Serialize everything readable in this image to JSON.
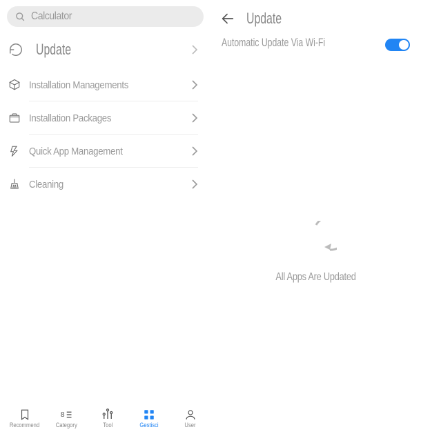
{
  "search": {
    "placeholder": "Calculator"
  },
  "menu": {
    "primary": {
      "icon": "refresh",
      "label": "Update"
    },
    "items": [
      {
        "icon": "cube",
        "label": "Installation Managements"
      },
      {
        "icon": "box",
        "label": "Installation Packages"
      },
      {
        "icon": "bolt",
        "label": "Quick App Management"
      },
      {
        "icon": "broom",
        "label": "Cleaning"
      }
    ]
  },
  "detail": {
    "title": "Update",
    "toggle_label": "Automatic Update Via Wi-Fi",
    "toggle_on": true,
    "status_text": "All Apps Are Updated"
  },
  "nav": {
    "items": [
      {
        "icon": "bookmark",
        "label": "Recommend",
        "active": false
      },
      {
        "icon": "grid8",
        "label": "Category",
        "active": false
      },
      {
        "icon": "bars",
        "label": "Tool",
        "active": false
      },
      {
        "icon": "squares",
        "label": "Gestisci",
        "active": true
      },
      {
        "icon": "user",
        "label": "User",
        "active": false
      }
    ]
  }
}
